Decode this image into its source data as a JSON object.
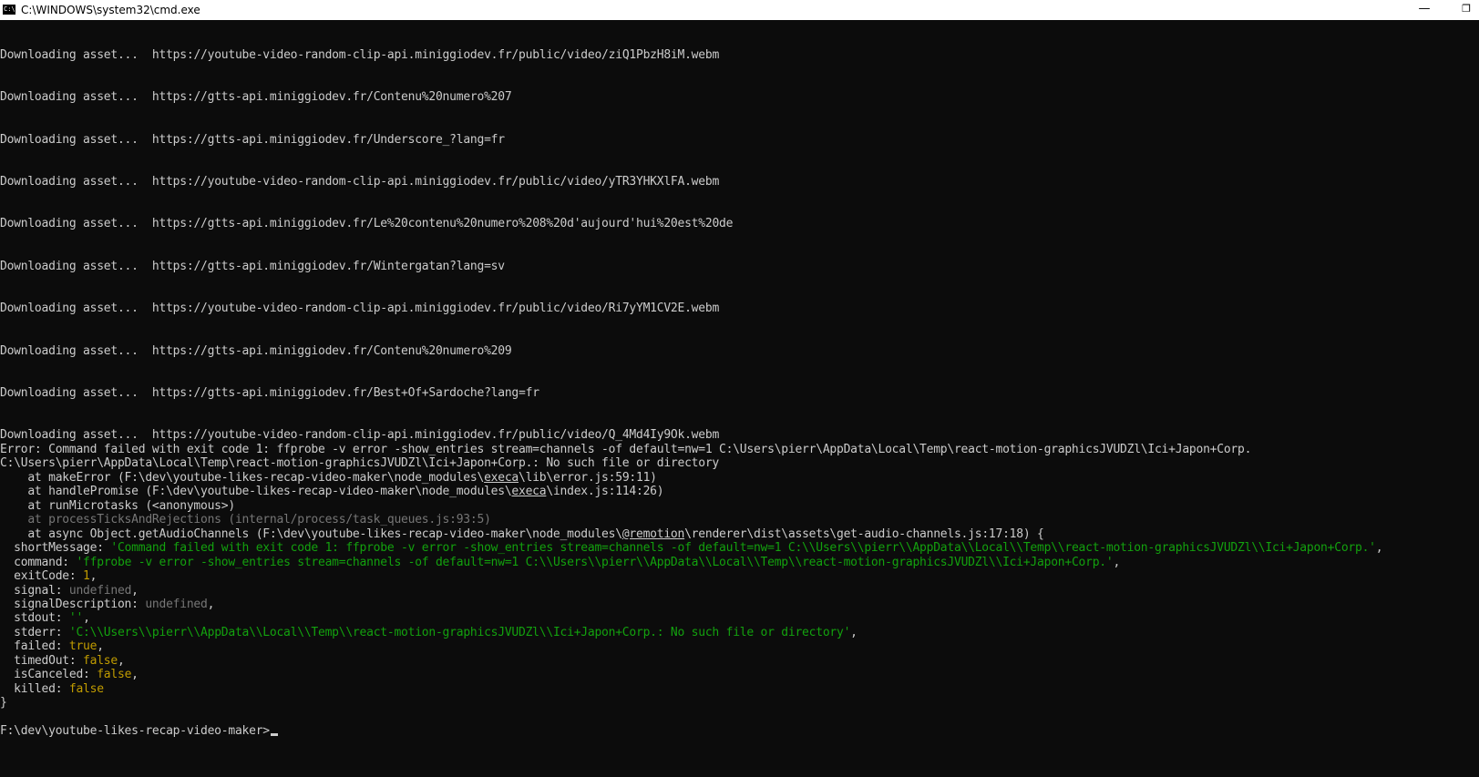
{
  "window": {
    "title": "C:\\WINDOWS\\system32\\cmd.exe",
    "icon_label": "C:\\",
    "minimize_glyph": "—",
    "maximize_glyph": "❐",
    "colors": {
      "titlebar": "#ffffff",
      "background": "#0c0c0c",
      "text": "#cccccc",
      "string": "#13a10e",
      "literal": "#c19c00",
      "dim": "#767676"
    }
  },
  "downloads": {
    "prefix": "Downloading asset...  ",
    "urls": [
      "https://youtube-video-random-clip-api.miniggiodev.fr/public/video/ziQ1PbzH8iM.webm",
      "https://gtts-api.miniggiodev.fr/Contenu%20numero%207",
      "https://gtts-api.miniggiodev.fr/Underscore_?lang=fr",
      "https://youtube-video-random-clip-api.miniggiodev.fr/public/video/yTR3YHKXlFA.webm",
      "https://gtts-api.miniggiodev.fr/Le%20contenu%20numero%208%20d'aujourd'hui%20est%20de",
      "https://gtts-api.miniggiodev.fr/Wintergatan?lang=sv",
      "https://youtube-video-random-clip-api.miniggiodev.fr/public/video/Ri7yYM1CV2E.webm",
      "https://gtts-api.miniggiodev.fr/Contenu%20numero%209",
      "https://gtts-api.miniggiodev.fr/Best+Of+Sardoche?lang=fr",
      "https://youtube-video-random-clip-api.miniggiodev.fr/public/video/Q_4Md4Iy9Ok.webm"
    ]
  },
  "error": {
    "line1": "Error: Command failed with exit code 1: ffprobe -v error -show_entries stream=channels -of default=nw=1 C:\\Users\\pierr\\AppData\\Local\\Temp\\react-motion-graphicsJVUDZl\\Ici+Japon+Corp.",
    "line2": "C:\\Users\\pierr\\AppData\\Local\\Temp\\react-motion-graphicsJVUDZl\\Ici+Japon+Corp.: No such file or directory",
    "stack": {
      "make_error_pre": "    at makeError (F:\\dev\\youtube-likes-recap-video-maker\\node_modules\\",
      "make_error_mod": "execa",
      "make_error_post": "\\lib\\error.js:59:11)",
      "handle_promise_pre": "    at handlePromise (F:\\dev\\youtube-likes-recap-video-maker\\node_modules\\",
      "handle_promise_mod": "execa",
      "handle_promise_post": "\\index.js:114:26)",
      "run_microtasks": "    at runMicrotasks (<anonymous>)",
      "process_ticks": "    at processTicksAndRejections (internal/process/task_queues.js:93:5)",
      "async_pre": "    at async Object.getAudioChannels (F:\\dev\\youtube-likes-recap-video-maker\\node_modules\\",
      "async_mod": "@remotion",
      "async_post": "\\renderer\\dist\\assets\\get-audio-channels.js:17:18) {"
    },
    "props": {
      "short_message_key": "  shortMessage: ",
      "short_message_val": "'Command failed with exit code 1: ffprobe -v error -show_entries stream=channels -of default=nw=1 C:\\\\Users\\\\pierr\\\\AppData\\\\Local\\\\Temp\\\\react-motion-graphicsJVUDZl\\\\Ici+Japon+Corp.'",
      "comma": ",",
      "command_key": "  command: ",
      "command_val": "'ffprobe -v error -show_entries stream=channels -of default=nw=1 C:\\\\Users\\\\pierr\\\\AppData\\\\Local\\\\Temp\\\\react-motion-graphicsJVUDZl\\\\Ici+Japon+Corp.'",
      "exit_code_key": "  exitCode: ",
      "exit_code_val": "1",
      "signal_key": "  signal: ",
      "signal_val": "undefined",
      "signal_desc_key": "  signalDescription: ",
      "signal_desc_val": "undefined",
      "stdout_key": "  stdout: ",
      "stdout_val": "''",
      "stderr_key": "  stderr: ",
      "stderr_val": "'C:\\\\Users\\\\pierr\\\\AppData\\\\Local\\\\Temp\\\\react-motion-graphicsJVUDZl\\\\Ici+Japon+Corp.: No such file or directory'",
      "failed_key": "  failed: ",
      "failed_val": "true",
      "timed_out_key": "  timedOut: ",
      "timed_out_val": "false",
      "is_canceled_key": "  isCanceled: ",
      "is_canceled_val": "false",
      "killed_key": "  killed: ",
      "killed_val": "false"
    },
    "close_brace": "}"
  },
  "prompt": "F:\\dev\\youtube-likes-recap-video-maker>"
}
